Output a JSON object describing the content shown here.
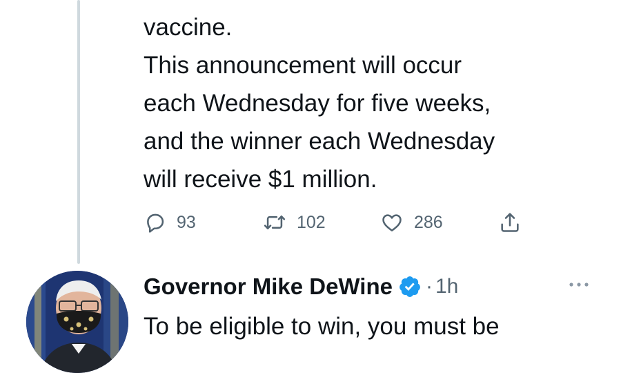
{
  "tweet1": {
    "lines": [
      "vaccine.",
      "This announcement will occur",
      "each Wednesday for five weeks,",
      "and the winner each Wednesday",
      "will receive $1 million."
    ],
    "actions": {
      "reply_icon": "reply-icon",
      "reply_count": "93",
      "retweet_icon": "retweet-icon",
      "retweet_count": "102",
      "like_icon": "heart-icon",
      "like_count": "286",
      "share_icon": "share-icon"
    }
  },
  "tweet2": {
    "author_name": "Governor Mike DeWine",
    "verified_icon": "verified-badge-icon",
    "separator": "·",
    "time": "1h",
    "more_icon": "more-icon",
    "text_line": "To be eligible to win, you must be"
  },
  "colors": {
    "text": "#0f1419",
    "secondary": "#536471",
    "verified": "#1d9bf0",
    "thread_line": "#cfd9de"
  }
}
